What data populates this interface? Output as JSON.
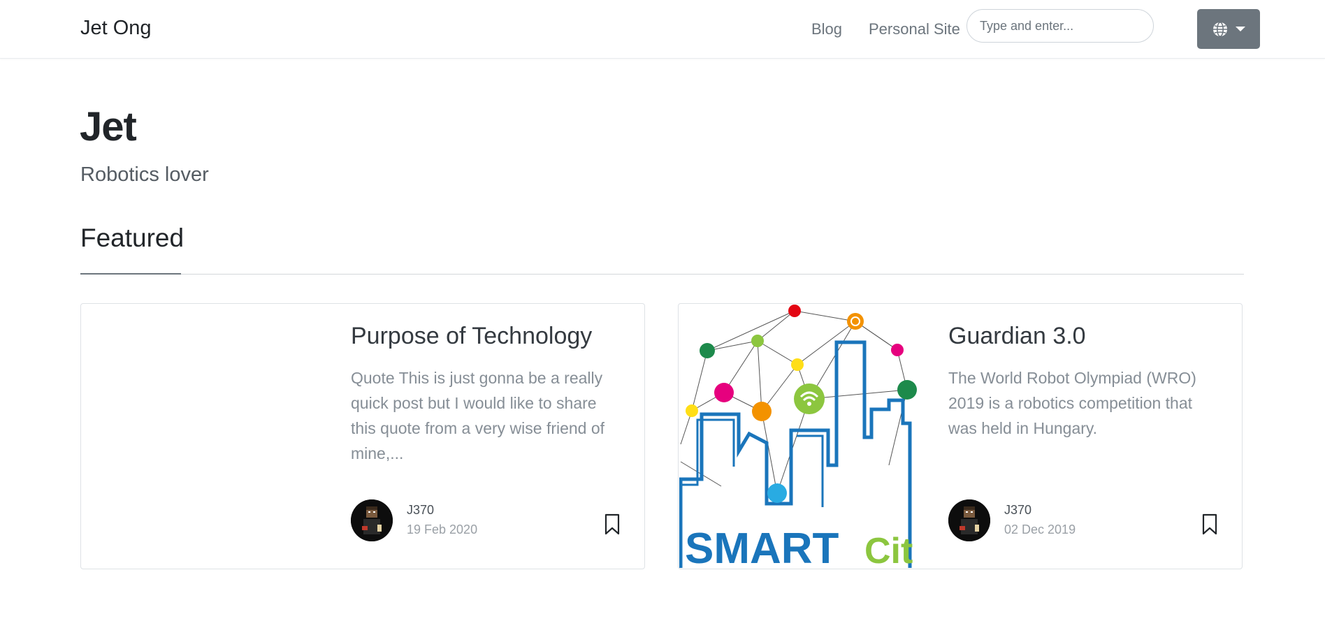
{
  "navbar": {
    "brand": "Jet Ong",
    "links": [
      "Blog",
      "Personal Site"
    ],
    "search_placeholder": "Type and enter...",
    "language_icon": "globe-icon"
  },
  "header": {
    "title": "Jet",
    "subtitle": "Robotics lover"
  },
  "featured": {
    "heading": "Featured",
    "cards": [
      {
        "title": "Purpose of Technology",
        "excerpt": "Quote This is just gonna be a really quick post but I would like to share this quote from a very wise friend of mine,...",
        "author": "J370",
        "date": "19 Feb 2020",
        "image": "none"
      },
      {
        "title": "Guardian 3.0",
        "excerpt": "The World Robot Olympiad (WRO) 2019 is a robotics competition that was held in Hungary.",
        "author": "J370",
        "date": "02 Dec 2019",
        "image": "smart-city-illustration",
        "image_text_1": "SMART",
        "image_text_2": "Cit"
      }
    ]
  },
  "colors": {
    "nav_button": "#6c757d",
    "smart_blue": "#1a75bb",
    "smart_green": "#8cc63f"
  }
}
